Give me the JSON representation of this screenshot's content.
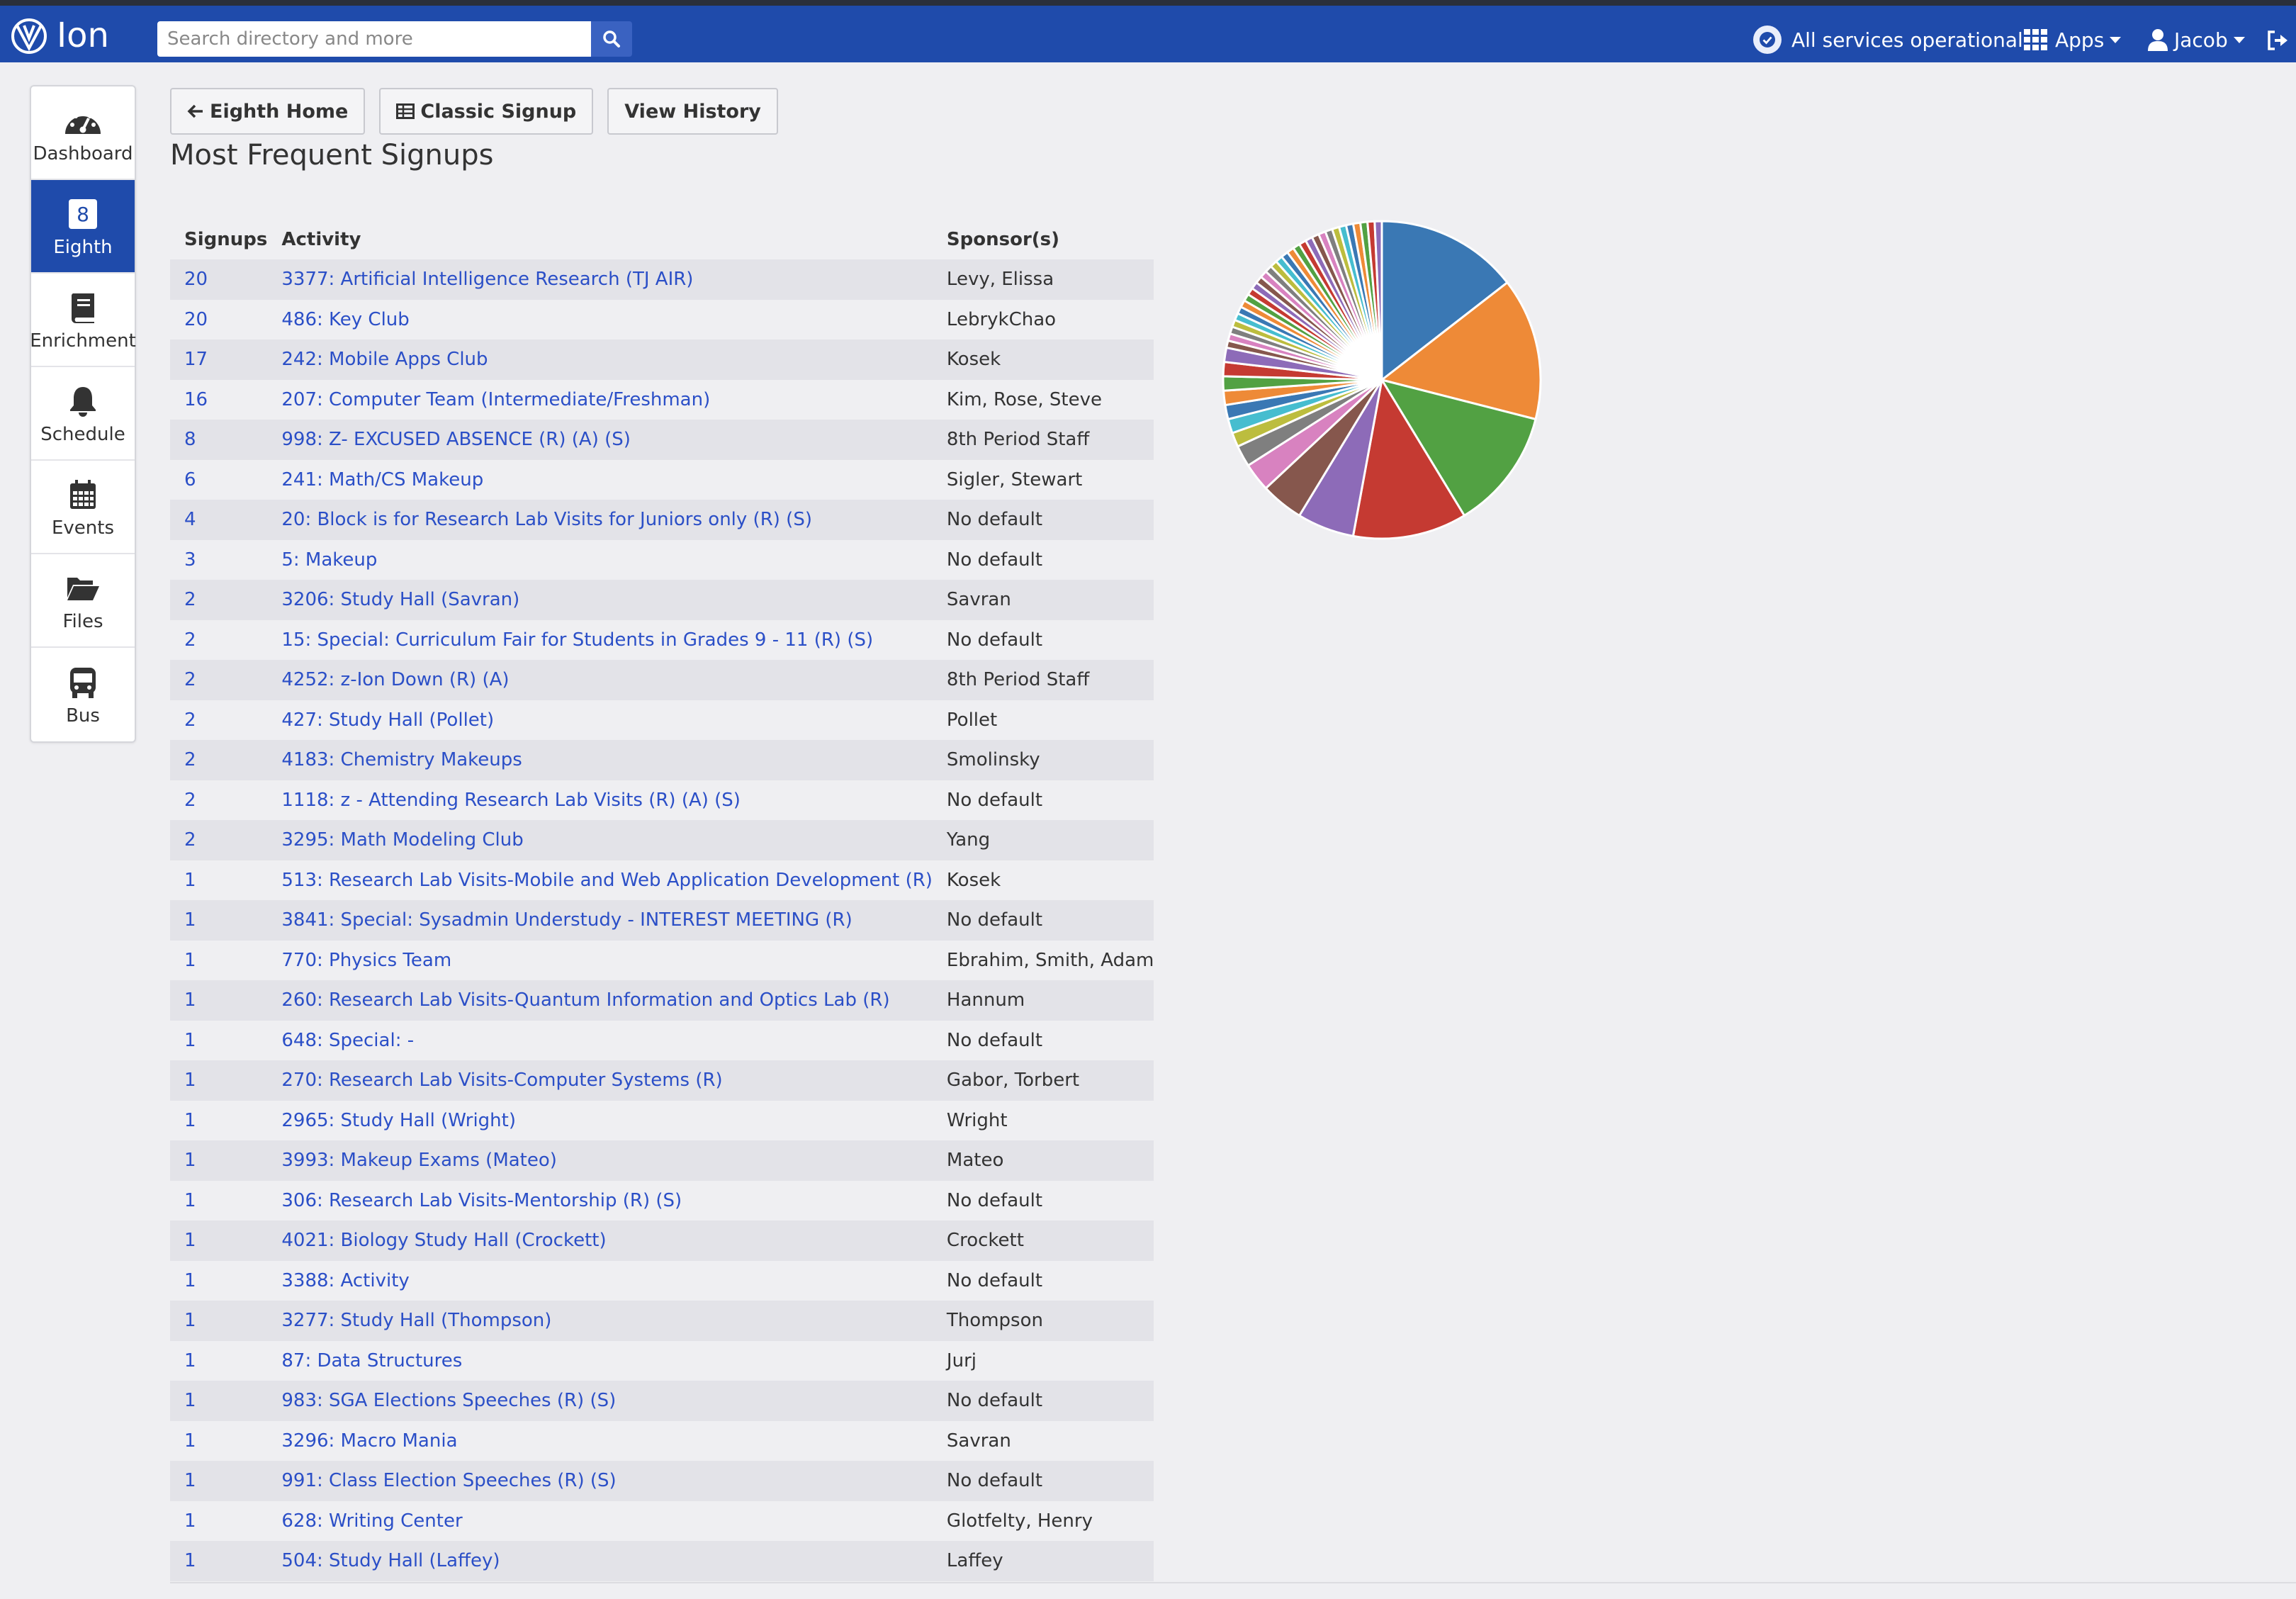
{
  "header": {
    "app_name": "Ion",
    "search_placeholder": "Search directory and more",
    "status_text": "All services operational",
    "apps_label": "Apps",
    "user_label": "Jacob"
  },
  "sidebar": {
    "items": [
      {
        "label": "Dashboard",
        "icon": "dashboard-icon"
      },
      {
        "label": "Eighth",
        "icon": "eighth-icon",
        "badge": "8",
        "active": true
      },
      {
        "label": "Enrichment",
        "icon": "book-icon"
      },
      {
        "label": "Schedule",
        "icon": "bell-icon"
      },
      {
        "label": "Events",
        "icon": "calendar-icon"
      },
      {
        "label": "Files",
        "icon": "folder-icon"
      },
      {
        "label": "Bus",
        "icon": "bus-icon"
      }
    ]
  },
  "toolbar": {
    "eighth_home": "Eighth Home",
    "classic_signup": "Classic Signup",
    "view_history": "View History"
  },
  "page": {
    "title": "Most Frequent Signups"
  },
  "table": {
    "headers": [
      "Signups",
      "Activity",
      "Sponsor(s)"
    ],
    "rows": [
      {
        "signups": "20",
        "activity": "3377: Artificial Intelligence Research (TJ AIR)",
        "sponsor": "Levy, Elissa"
      },
      {
        "signups": "20",
        "activity": "486: Key Club",
        "sponsor": "LebrykChao"
      },
      {
        "signups": "17",
        "activity": "242: Mobile Apps Club",
        "sponsor": "Kosek"
      },
      {
        "signups": "16",
        "activity": "207: Computer Team (Intermediate/Freshman)",
        "sponsor": "Kim, Rose, Steve"
      },
      {
        "signups": "8",
        "activity": "998: Z- EXCUSED ABSENCE (R) (A) (S)",
        "sponsor": "8th Period Staff"
      },
      {
        "signups": "6",
        "activity": "241: Math/CS Makeup",
        "sponsor": "Sigler, Stewart"
      },
      {
        "signups": "4",
        "activity": "20: Block is for Research Lab Visits for Juniors only (R) (S)",
        "sponsor": "No default"
      },
      {
        "signups": "3",
        "activity": "5: Makeup",
        "sponsor": "No default"
      },
      {
        "signups": "2",
        "activity": "3206: Study Hall (Savran)",
        "sponsor": "Savran"
      },
      {
        "signups": "2",
        "activity": "15: Special: Curriculum Fair for Students in Grades 9 - 11 (R) (S)",
        "sponsor": "No default"
      },
      {
        "signups": "2",
        "activity": "4252: z-Ion Down (R) (A)",
        "sponsor": "8th Period Staff"
      },
      {
        "signups": "2",
        "activity": "427: Study Hall (Pollet)",
        "sponsor": "Pollet"
      },
      {
        "signups": "2",
        "activity": "4183: Chemistry Makeups",
        "sponsor": "Smolinsky"
      },
      {
        "signups": "2",
        "activity": "1118: z - Attending Research Lab Visits (R) (A) (S)",
        "sponsor": "No default"
      },
      {
        "signups": "2",
        "activity": "3295: Math Modeling Club",
        "sponsor": "Yang"
      },
      {
        "signups": "1",
        "activity": "513: Research Lab Visits-Mobile and Web Application Development (R)",
        "sponsor": "Kosek"
      },
      {
        "signups": "1",
        "activity": "3841: Special: Sysadmin Understudy - INTEREST MEETING (R)",
        "sponsor": "No default"
      },
      {
        "signups": "1",
        "activity": "770: Physics Team",
        "sponsor": "Ebrahim, Smith, Adam"
      },
      {
        "signups": "1",
        "activity": "260: Research Lab Visits-Quantum Information and Optics Lab (R)",
        "sponsor": "Hannum"
      },
      {
        "signups": "1",
        "activity": "648: Special: -",
        "sponsor": "No default"
      },
      {
        "signups": "1",
        "activity": "270: Research Lab Visits-Computer Systems (R)",
        "sponsor": "Gabor, Torbert"
      },
      {
        "signups": "1",
        "activity": "2965: Study Hall (Wright)",
        "sponsor": "Wright"
      },
      {
        "signups": "1",
        "activity": "3993: Makeup Exams (Mateo)",
        "sponsor": "Mateo"
      },
      {
        "signups": "1",
        "activity": "306: Research Lab Visits-Mentorship (R) (S)",
        "sponsor": "No default"
      },
      {
        "signups": "1",
        "activity": "4021: Biology Study Hall (Crockett)",
        "sponsor": "Crockett"
      },
      {
        "signups": "1",
        "activity": "3388: Activity",
        "sponsor": "No default"
      },
      {
        "signups": "1",
        "activity": "3277: Study Hall (Thompson)",
        "sponsor": "Thompson"
      },
      {
        "signups": "1",
        "activity": "87: Data Structures",
        "sponsor": "Jurj"
      },
      {
        "signups": "1",
        "activity": "983: SGA Elections Speeches (R) (S)",
        "sponsor": "No default"
      },
      {
        "signups": "1",
        "activity": "3296: Macro Mania",
        "sponsor": "Savran"
      },
      {
        "signups": "1",
        "activity": "991: Class Election Speeches (R) (S)",
        "sponsor": "No default"
      },
      {
        "signups": "1",
        "activity": "628: Writing Center",
        "sponsor": "Glotfelty, Henry"
      },
      {
        "signups": "1",
        "activity": "504: Study Hall (Laffey)",
        "sponsor": "Laffey"
      }
    ]
  },
  "chart_data": {
    "type": "pie",
    "values": [
      20,
      20,
      17,
      16,
      8,
      6,
      4,
      3,
      2,
      2,
      2,
      2,
      2,
      2,
      2,
      1,
      1,
      1,
      1,
      1,
      1,
      1,
      1,
      1,
      1,
      1,
      1,
      1,
      1,
      1,
      1,
      1,
      1,
      1,
      1,
      1,
      1,
      1,
      1,
      1,
      1,
      1,
      1,
      1,
      1
    ],
    "colors": [
      "#3a78b4",
      "#ee8a37",
      "#52a143",
      "#c53a32",
      "#8d6bb8",
      "#86574d",
      "#d882c0",
      "#7f7f7f",
      "#bcbd3e",
      "#46bdcf"
    ]
  }
}
